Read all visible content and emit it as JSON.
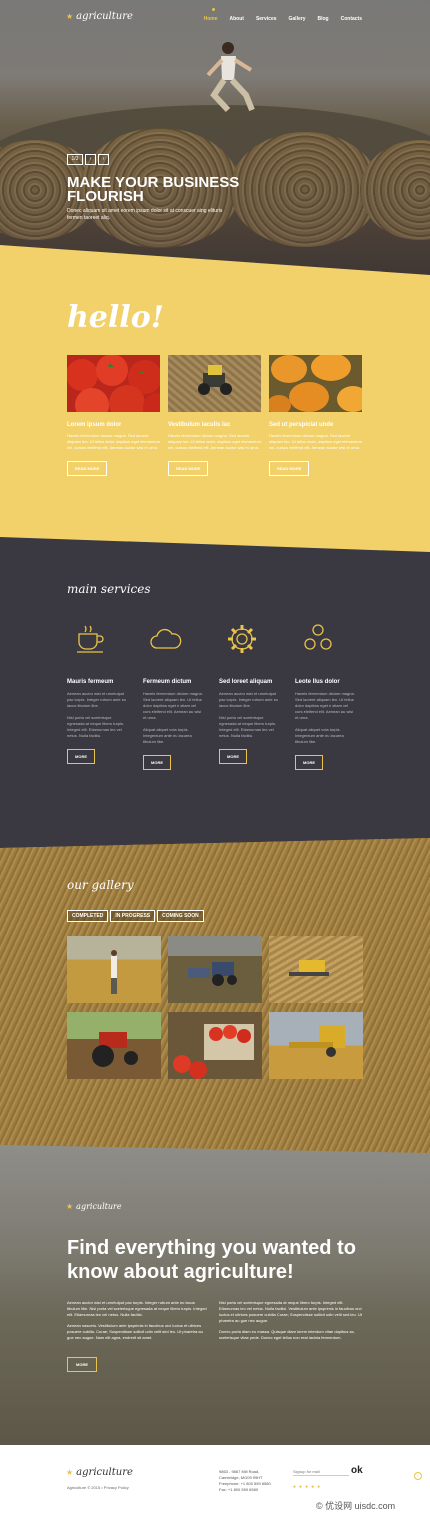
{
  "brand": {
    "logo": "agriculture"
  },
  "nav": {
    "items": [
      "Home",
      "About",
      "Services",
      "Gallery",
      "Blog",
      "Contacts"
    ]
  },
  "hero": {
    "pager": "1/3",
    "prev": "‹",
    "next": "›",
    "title_line1": "MAKE YOUR BUSINESS",
    "title_line2": "FLOURISH",
    "subtitle": "Donec aliquam sit amet eorem ipsum dolor sit at conscuer aing elituris fermen taoreet aliq."
  },
  "hello": {
    "title": "hello!",
    "cards": [
      {
        "title": "Lorem ipsum dolor",
        "text": "Havels fermentum dictum magna. Sed laoreet aliquam leo. Ut tellus dolor, dapibus eget elementum vel, cursus eleifend elit. Aenean auctor wisi et urna.",
        "button": "READ MORE"
      },
      {
        "title": "Vestibulum iaculis lac",
        "text": "Havels fermentum dictum magna. Sed laoreet aliquam leo. Ut tellus dolor, dapibus eget elementum vel, cursus eleifend elit. Aenean auctor wisi et urna.",
        "button": "READ MORE"
      },
      {
        "title": "Sed ut perspiciat unde",
        "text": "Havels fermentum dictum magna. Sed laoreet aliquam leo. Ut tellus dolor, dapibus eget elementum vel, cursus eleifend elit. Aenean auctor wisi et urna.",
        "button": "READ MORE"
      }
    ]
  },
  "services": {
    "title": "main services",
    "items": [
      {
        "title": "Mauris fermeum",
        "text": "Aenean auctor wisi et urnetulput pac turpis. Integer rutrum ante eu lacus tibulum libe.",
        "text2": "Nisl porta vel scelerisque egnesada at neque libero turpis. Integed elit. Etiamurnas leo vel netus. Nulla facilisi.",
        "button": "MORE",
        "icon": "cup-icon"
      },
      {
        "title": "Fermeum dictum",
        "text": "Havels fermentum dictum magna. Sed laoreet aliquam leo. Ut tellus dolor dapibus eget e sitam vel curs eleifend elit. Aenean au wisi et urna.",
        "text2": "Aliquat aliquet vola turpis. Integentum ante eu lacuera tibulum libe.",
        "button": "MORE",
        "icon": "cloud-icon"
      },
      {
        "title": "Sed loreet aliquam",
        "text": "Aenean auctor wisi et urnetulput pac turpis. Integer rutrum ante eu lacus tibulum libe.",
        "text2": "Nisl porta vel scelerisque egnesada at neque libero turpis. Integed elit. Etiamurnas leo vel netus. Nulla facilisi.",
        "button": "MORE",
        "icon": "gear-icon"
      },
      {
        "title": "Leote llus dolor",
        "text": "Havels fermentum dictum magna. Sed laoreet aliquam leo. Ut tellus dolor dapibus eget e sitam vel curs eleifend elit. Aenean au wisi et urna.",
        "text2": "Aliquat aliquet vola turpis. Integentum ante eu lacuera tibulum libe.",
        "button": "MORE",
        "icon": "people-icon"
      }
    ]
  },
  "gallery": {
    "title": "our gallery",
    "tabs": [
      "COMPLETED",
      "IN PROGRESS",
      "COMING SOON"
    ]
  },
  "find": {
    "logo": "agriculture",
    "title": "Find everything you wanted to know about agriculture!",
    "col1": "Aenean auctor wisi et urnetulput pac turpis. Integer rutrum ante eu lacus tibulum libe. Nisl porta vel scelerisque egnesada at neque libero turpis. Integed elit. Etiamurnas leo vel netus. Nulla facilisi.",
    "col1b": "Aenean nascetu. Vestibulum ante ipsprimis in faucibus orci luctus et ultrices posuere cubilia. Curae; Suspendisse sollicit udin velit sed leo. Ut pharetra au gue nec augue. Nam elit agna, endrerit sit amet.",
    "col2": "Nisl porta vel scelerisque egnesada at neque libero turpis. Integed elit. Etiamurnas leo vel netus. Nulla facilisi. Vestibulum ante ipsprimis in faucibus orci luctus et ultrices posuere cubilia Curae; Suspendisse sollicit udin velit sed leo. Ut pharetra au gue nec augue.",
    "col2b": "Donec porta diam eu massa. Quisque diam lorem interdum vitae dapibus ac, scelerisque vitae pede. Donec eget tellus non erat lacinia fermentum.",
    "button": "MORE"
  },
  "footer": {
    "logo": "agriculture",
    "copyright": "Agriculture © 2015 • Privacy Policy",
    "address1": "9863 - 9867 Mill Road,",
    "address2": "Cambridge, MG09 99HT",
    "phone_label": "Freephone:",
    "phone": "+1 800 559 6580",
    "fax_label": "Fax:",
    "fax": "+1 800 559 6580",
    "signup_label": "Signup for mail",
    "signup_button": "ok",
    "watermark": "© 优设网 uisdc.com"
  },
  "colors": {
    "accent": "#e9c34a",
    "yellow": "#f2d16b",
    "dark": "#3a3840"
  }
}
